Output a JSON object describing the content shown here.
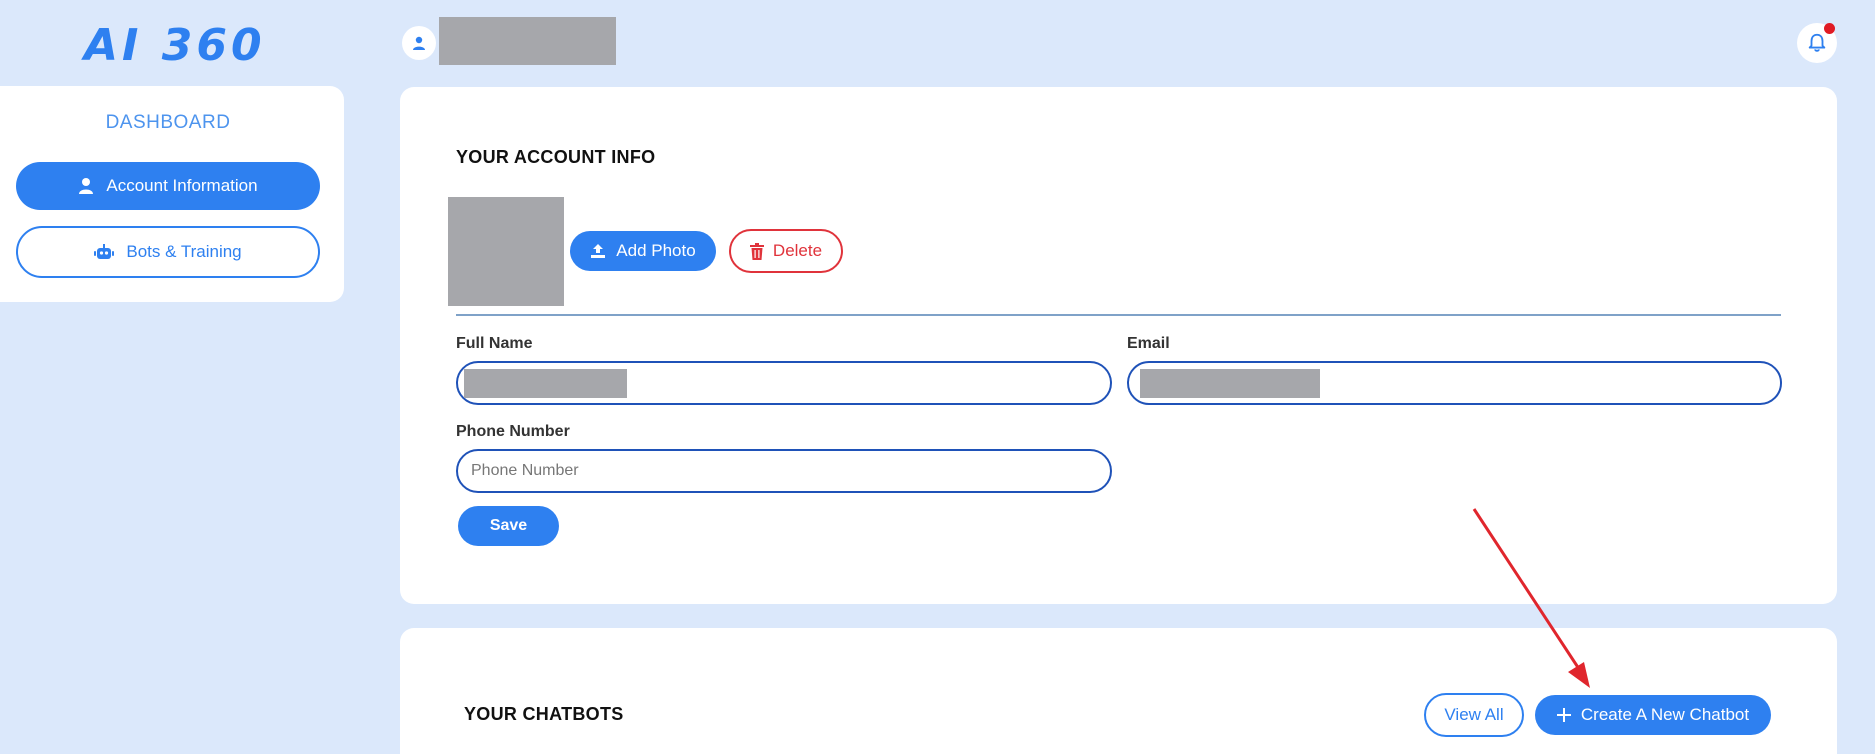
{
  "app": {
    "logo_text": "AI 360",
    "brand_color": "#2e80f0",
    "danger_color": "#e0333b"
  },
  "header": {
    "user_icon": "user-icon",
    "notification_icon": "bell-icon",
    "has_unread_notifications": true
  },
  "sidebar": {
    "title": "DASHBOARD",
    "items": [
      {
        "label": "Account Information",
        "icon": "user-icon",
        "active": true
      },
      {
        "label": "Bots & Training",
        "icon": "robot-icon",
        "active": false
      }
    ]
  },
  "account": {
    "title": "YOUR ACCOUNT INFO",
    "add_photo_label": "Add Photo",
    "delete_label": "Delete",
    "full_name_label": "Full Name",
    "email_label": "Email",
    "phone_label": "Phone Number",
    "phone_placeholder": "Phone Number",
    "save_label": "Save"
  },
  "chatbots": {
    "title": "YOUR CHATBOTS",
    "view_all_label": "View All",
    "create_label": "Create A New Chatbot"
  },
  "annotation": {
    "color": "#e0262d",
    "points_to": "create-chatbot-button"
  }
}
